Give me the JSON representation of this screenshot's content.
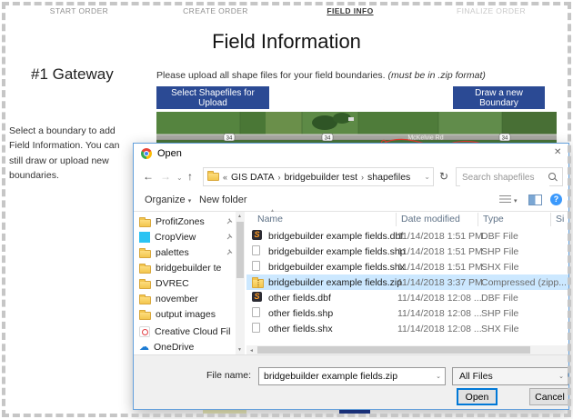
{
  "page": {
    "nav": {
      "items": [
        {
          "label": "START ORDER"
        },
        {
          "label": "CREATE ORDER"
        },
        {
          "label": "FIELD INFO"
        },
        {
          "label": "FINALIZE ORDER"
        }
      ]
    },
    "title": "Field Information",
    "section_heading": "#1 Gateway",
    "instruction": "Please upload all shape files for your field boundaries.",
    "instruction_note": "(must be in .zip format)",
    "helper_text": "Select a boundary to add Field Information. You can still draw or upload new boundaries.",
    "select_shapefiles_button": "Select Shapefiles for Upload",
    "draw_boundary_button": "Draw a new Boundary",
    "map": {
      "road_label": "McKelvie Rd",
      "route_shield": "34"
    }
  },
  "dialog": {
    "title": "Open",
    "icons": {
      "back": "←",
      "forward": "→",
      "drop": "⌄",
      "up": "↑",
      "refresh": "↻",
      "close": "✕",
      "help": "?"
    },
    "breadcrumb": {
      "prefix": "«",
      "separator": "›",
      "segments": [
        "GIS DATA",
        "bridgebuilder test",
        "shapefiles"
      ]
    },
    "search_placeholder": "Search shapefiles",
    "toolbar": {
      "organize_label": "Organize",
      "new_folder_label": "New folder"
    },
    "nav_pane": {
      "items": [
        {
          "label": "ProfitZones"
        },
        {
          "label": "CropView"
        },
        {
          "label": "palettes"
        },
        {
          "label": "bridgebuilder te"
        },
        {
          "label": "DVREC"
        },
        {
          "label": "november"
        },
        {
          "label": "output images"
        },
        {
          "label": "Creative Cloud Fil"
        },
        {
          "label": "OneDrive"
        }
      ]
    },
    "file_list": {
      "columns": {
        "name": "Name",
        "date": "Date modified",
        "type": "Type",
        "size": "Si"
      },
      "rows": [
        {
          "name": "bridgebuilder example fields.dbf",
          "date": "11/14/2018 1:51 PM",
          "type": "DBF File"
        },
        {
          "name": "bridgebuilder example fields.shp",
          "date": "11/14/2018 1:51 PM",
          "type": "SHP File"
        },
        {
          "name": "bridgebuilder example fields.shx",
          "date": "11/14/2018 1:51 PM",
          "type": "SHX File"
        },
        {
          "name": "bridgebuilder example fields.zip",
          "date": "11/14/2018 3:37 PM",
          "type": "Compressed (zipp...",
          "selected": true
        },
        {
          "name": "other fields.dbf",
          "date": "11/14/2018 12:08 ...",
          "type": "DBF File"
        },
        {
          "name": "other fields.shp",
          "date": "11/14/2018 12:08 ...",
          "type": "SHP File"
        },
        {
          "name": "other fields.shx",
          "date": "11/14/2018 12:08 ...",
          "type": "SHX File"
        }
      ]
    },
    "footer": {
      "file_name_label": "File name:",
      "file_name_value": "bridgebuilder example fields.zip",
      "file_type_value": "All Files",
      "open_button": "Open",
      "cancel_button": "Cancel"
    }
  },
  "colors": {
    "accent_blue": "#2b4a94",
    "selection": "#cce8ff",
    "dialog_border": "#64a0dc"
  }
}
